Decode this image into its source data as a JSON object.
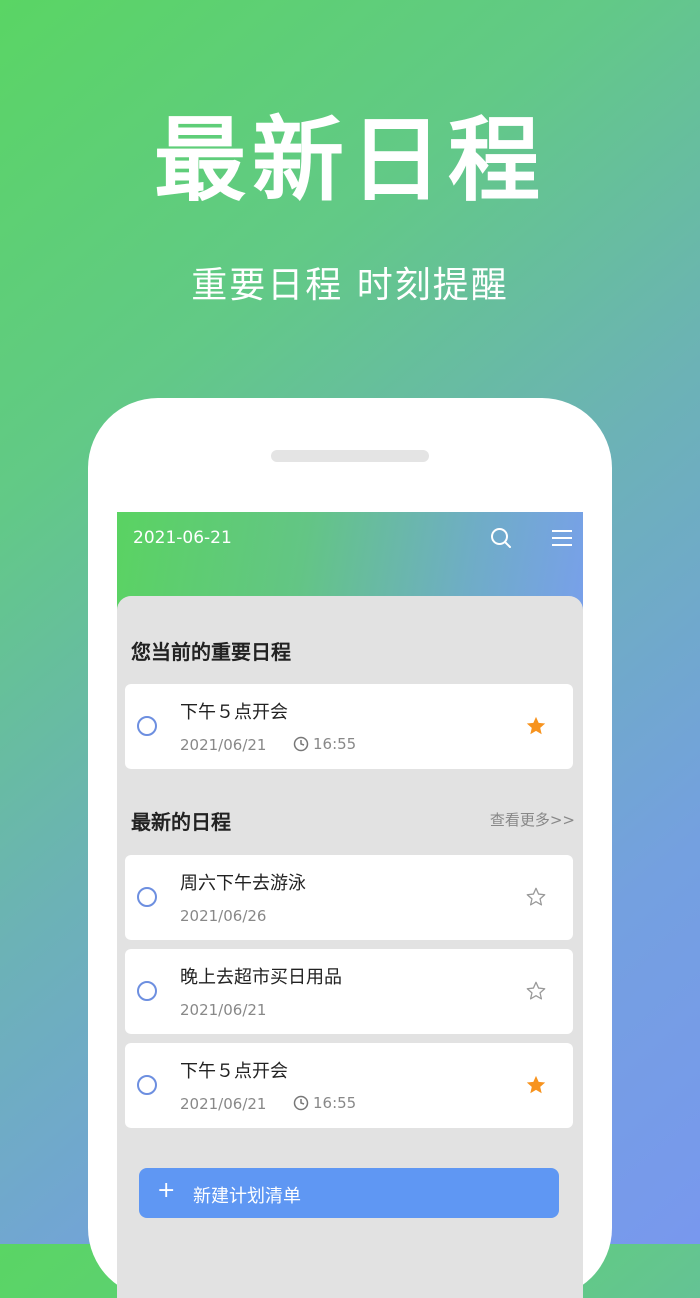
{
  "hero": {
    "title": "最新日程",
    "subtitle": "重要日程 时刻提醒"
  },
  "app": {
    "header": {
      "date": "2021-06-21",
      "search_icon": "search-icon",
      "menu_icon": "menu-icon"
    },
    "important_section": {
      "title": "您当前的重要日程",
      "items": [
        {
          "title": "下午５点开会",
          "date": "2021/06/21",
          "time": "16:55",
          "starred": true
        }
      ]
    },
    "latest_section": {
      "title": "最新的日程",
      "more_link": "查看更多>>",
      "items": [
        {
          "title": "周六下午去游泳",
          "date": "2021/06/26",
          "starred": false
        },
        {
          "title": "晚上去超市买日用品",
          "date": "2021/06/21",
          "starred": false
        },
        {
          "title": "下午５点开会",
          "date": "2021/06/21",
          "time": "16:55",
          "starred": true
        }
      ]
    },
    "add_button": {
      "icon": "plus-icon",
      "label": "新建计划清单"
    },
    "colors": {
      "accent_blue": "#5f97f3",
      "radio_blue": "#6d8fe0",
      "star_orange": "#f7931e",
      "star_outline": "#999999"
    }
  }
}
